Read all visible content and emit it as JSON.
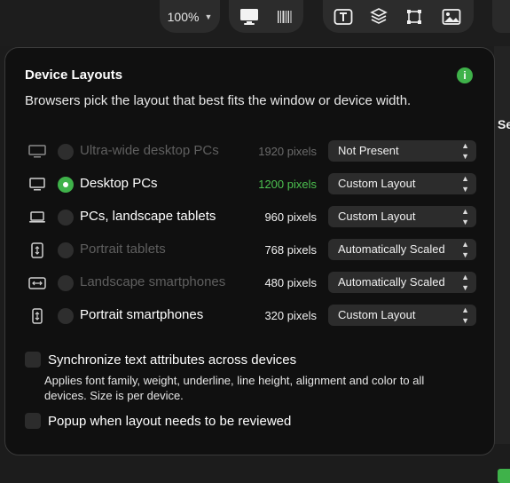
{
  "toolbar": {
    "zoom": "100%",
    "icons": [
      "desktop-icon",
      "barcode-icon",
      "text-icon",
      "layers-icon",
      "crop-icon",
      "image-icon"
    ]
  },
  "right_peek": {
    "label": "Se"
  },
  "popover": {
    "title": "Device Layouts",
    "subtitle": "Browsers pick the layout that best fits the window or device width.",
    "rows": [
      {
        "icon": "ultrawide-monitor-icon",
        "label": "Ultra-wide desktop PCs",
        "pixels": "1920 pixels",
        "layout": "Not Present",
        "state": "disabled"
      },
      {
        "icon": "desktop-monitor-icon",
        "label": "Desktop PCs",
        "pixels": "1200 pixels",
        "layout": "Custom Layout",
        "state": "selected"
      },
      {
        "icon": "laptop-icon",
        "label": "PCs, landscape tablets",
        "pixels": "960 pixels",
        "layout": "Custom Layout",
        "state": "normal"
      },
      {
        "icon": "tablet-portrait-icon",
        "label": "Portrait tablets",
        "pixels": "768 pixels",
        "layout": "Automatically Scaled",
        "state": "dim-label"
      },
      {
        "icon": "phone-landscape-icon",
        "label": "Landscape smartphones",
        "pixels": "480 pixels",
        "layout": "Automatically Scaled",
        "state": "dim-label"
      },
      {
        "icon": "phone-portrait-icon",
        "label": "Portrait smartphones",
        "pixels": "320 pixels",
        "layout": "Custom Layout",
        "state": "normal"
      }
    ],
    "sync_label": "Synchronize text attributes across devices",
    "sync_desc": "Applies font family, weight, underline, line height, alignment and color to all devices. Size is per device.",
    "popup_label": "Popup when layout needs to be reviewed"
  },
  "colors": {
    "accent": "#3fb24a",
    "background": "#101010",
    "control": "#2c2c2c"
  }
}
